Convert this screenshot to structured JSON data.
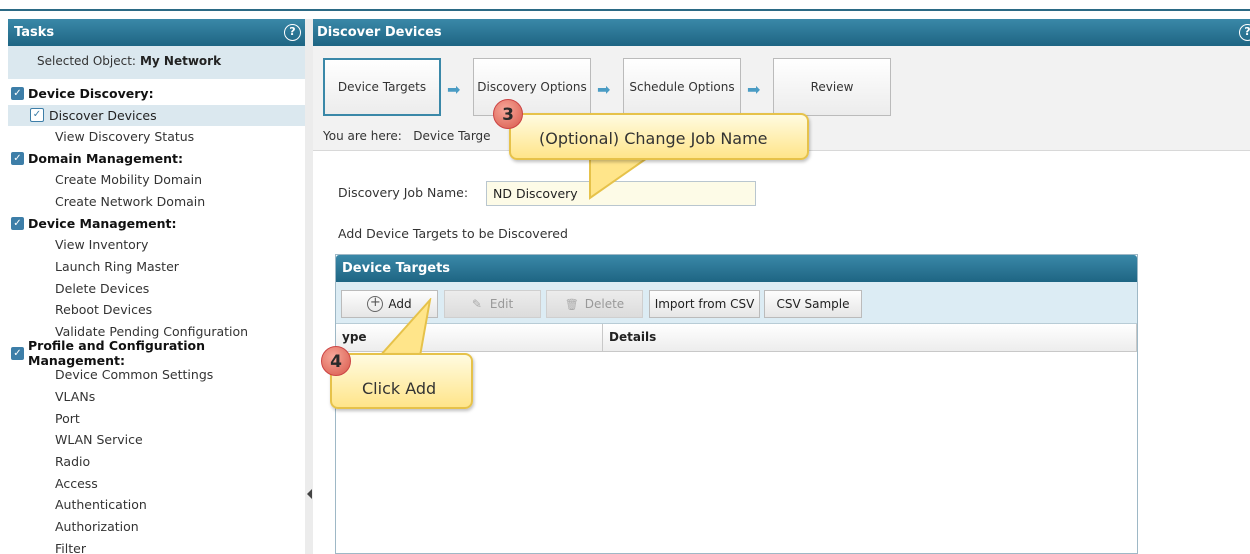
{
  "left_panel": {
    "title": "Tasks",
    "help_icon": "?",
    "selected_object_label": "Selected Object:",
    "selected_object_value": "My Network",
    "sections": [
      {
        "title": "Device Discovery:",
        "items": [
          {
            "label": "Discover Devices",
            "active": true
          },
          {
            "label": "View Discovery Status"
          }
        ]
      },
      {
        "title": "Domain Management:",
        "items": [
          {
            "label": "Create Mobility Domain"
          },
          {
            "label": "Create Network Domain"
          }
        ]
      },
      {
        "title": "Device Management:",
        "items": [
          {
            "label": "View Inventory"
          },
          {
            "label": "Launch Ring Master"
          },
          {
            "label": "Delete Devices"
          },
          {
            "label": "Reboot Devices"
          },
          {
            "label": "Validate Pending Configuration"
          }
        ]
      },
      {
        "title": "Profile and Configuration Management:",
        "items": [
          {
            "label": "Device Common Settings"
          },
          {
            "label": "VLANs"
          },
          {
            "label": "Port"
          },
          {
            "label": "WLAN Service"
          },
          {
            "label": "Radio"
          },
          {
            "label": "Access"
          },
          {
            "label": "Authentication"
          },
          {
            "label": "Authorization"
          },
          {
            "label": "Filter"
          }
        ]
      }
    ]
  },
  "right_panel": {
    "title": "Discover Devices",
    "help_icon": "?",
    "wizard": {
      "steps": [
        {
          "label": "Device Targets"
        },
        {
          "label": "Discovery Options"
        },
        {
          "label": "Schedule Options"
        },
        {
          "label": "Review"
        }
      ],
      "you_are_here_label": "You are here:",
      "you_are_here_value": "Device Targe"
    },
    "job_name_label": "Discovery Job Name:",
    "job_name_value": "ND Discovery",
    "add_targets_label": "Add Device Targets to be Discovered",
    "device_targets": {
      "title": "Device Targets",
      "buttons": {
        "add": "Add",
        "edit": "Edit",
        "delete": "Delete",
        "import_csv": "Import from CSV",
        "csv_sample": "CSV Sample"
      },
      "columns": [
        "ype",
        "Details"
      ]
    }
  },
  "callouts": {
    "step3": {
      "number": "3",
      "text": "(Optional) Change Job Name"
    },
    "step4": {
      "number": "4",
      "text": "Click Add"
    }
  },
  "colors": {
    "header_blue": "#1e6583",
    "callout_yellow": "#ffe58a",
    "badge_red": "#d8584a"
  }
}
